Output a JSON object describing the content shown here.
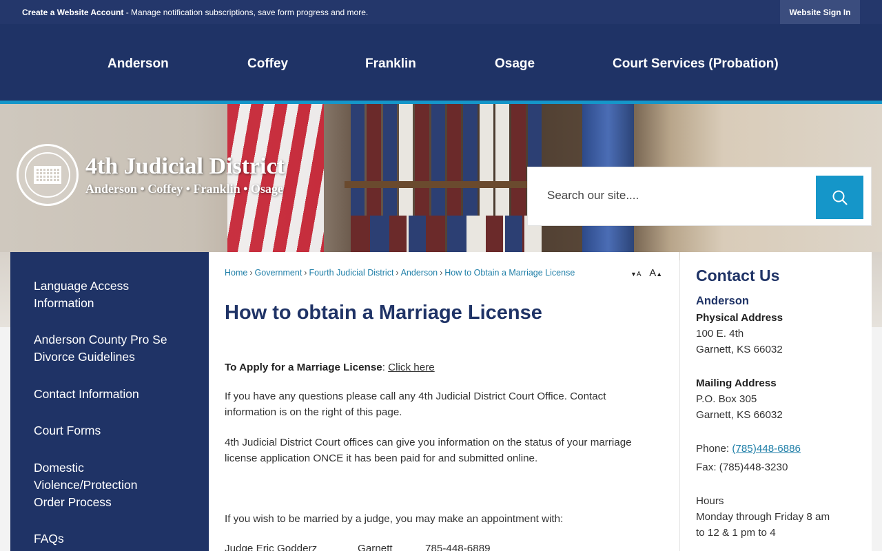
{
  "topbar": {
    "create_account": "Create a Website Account",
    "message": " - Manage notification subscriptions, save form progress and more.",
    "signin": "Website Sign In"
  },
  "nav": [
    "Anderson",
    "Coffey",
    "Franklin",
    "Osage",
    "Court Services (Probation)"
  ],
  "banner": {
    "title": "4th Judicial District",
    "subtitle": "Anderson • Coffey • Franklin • Osage"
  },
  "search": {
    "placeholder": "Search our site...."
  },
  "sidebar": {
    "items": [
      "Language Access Information",
      "Anderson County Pro Se Divorce Guidelines",
      "Contact Information",
      "Court Forms",
      "Domestic Violence/Protection Order Process",
      "FAQs"
    ]
  },
  "breadcrumb": [
    "Home",
    "Government",
    "Fourth Judicial District",
    "Anderson",
    "How to Obtain a Marriage License"
  ],
  "resize": {
    "decrease": "A",
    "increase": "A"
  },
  "content": {
    "title": "How to obtain a Marriage License",
    "apply_label": "To Apply for a Marriage License",
    "apply_colon": ": ",
    "apply_link": "Click here",
    "para1": "If you have any questions please call any 4th Judicial District Court Office. Contact information is on the right of this page.",
    "para2": "4th Judicial District Court offices can give you information on the status of your marriage license application ONCE it has been paid for and submitted online.",
    "para3": "If you wish to be married by a judge, you may make an appointment with:",
    "judge": {
      "name": "Judge Eric Godderz",
      "city": "Garnett",
      "phone": "785-448-6889"
    }
  },
  "contact": {
    "heading": "Contact Us",
    "county": "Anderson",
    "physical_label": "Physical Address",
    "physical_line1": "100 E. 4th",
    "physical_line2": "Garnett, KS 66032",
    "mailing_label": "Mailing Address",
    "mailing_line1": "P.O. Box 305",
    "mailing_line2": "Garnett, KS 66032",
    "phone_label": "Phone: ",
    "phone": "(785)448-6886",
    "fax": "Fax: (785)448-3230",
    "hours_label": "Hours",
    "hours_line1": "Monday through Friday 8 am",
    "hours_line2": "to 12 & 1 pm to 4"
  },
  "colors": {
    "navy": "#1f3366",
    "accent": "#1596c9",
    "link": "#1f7fa8"
  }
}
